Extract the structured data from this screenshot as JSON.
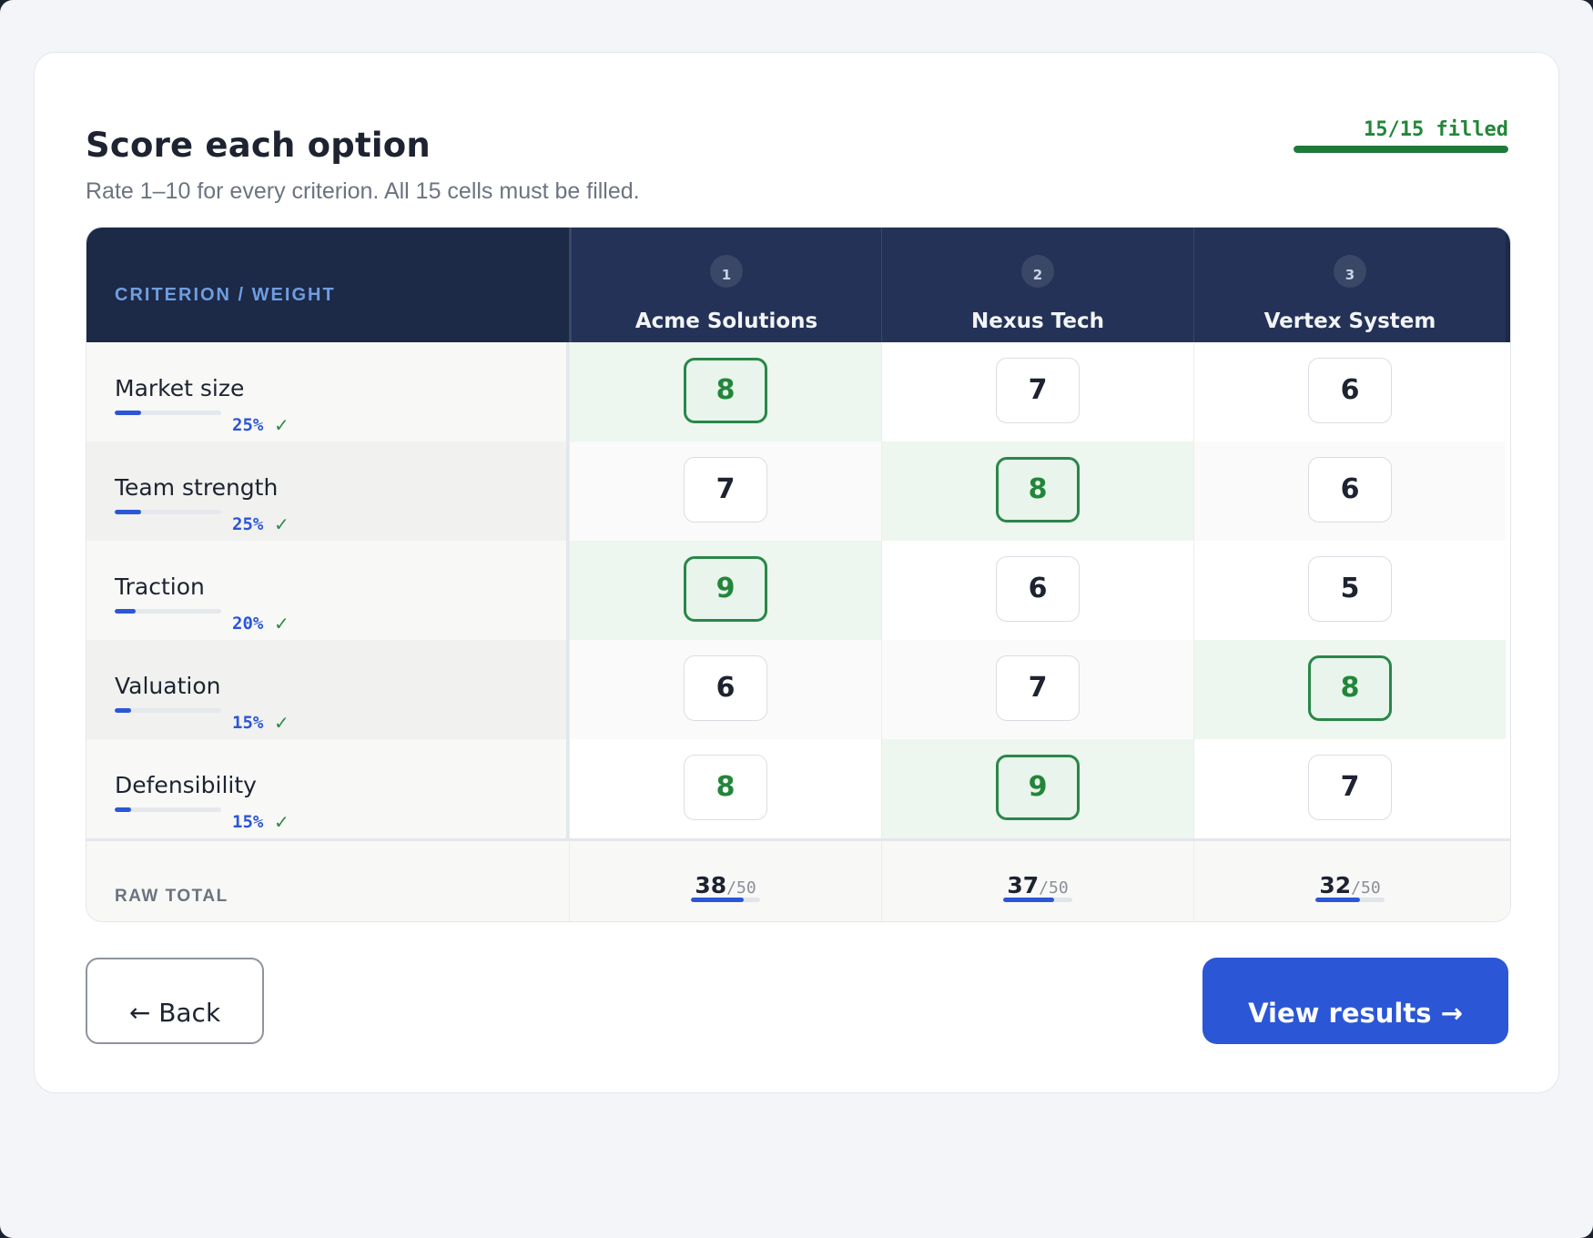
{
  "header": {
    "title": "Score each option",
    "subtitle": "Rate 1–10 for every criterion. All 15 cells must be filled.",
    "progress_label": "15/15 filled",
    "progress_fraction": 1.0
  },
  "table": {
    "criterion_header": "CRITERION / WEIGHT",
    "options": [
      {
        "number": "1",
        "name": "Acme Solutions"
      },
      {
        "number": "2",
        "name": "Nexus Tech"
      },
      {
        "number": "3",
        "name": "Vertex System"
      }
    ],
    "criteria": [
      {
        "name": "Market size",
        "weight": "25%",
        "weight_value": 0.25,
        "check": "✓",
        "scores": [
          "8",
          "7",
          "6"
        ],
        "best_index": 0
      },
      {
        "name": "Team strength",
        "weight": "25%",
        "weight_value": 0.25,
        "check": "✓",
        "scores": [
          "7",
          "8",
          "6"
        ],
        "best_index": 1
      },
      {
        "name": "Traction",
        "weight": "20%",
        "weight_value": 0.2,
        "check": "✓",
        "scores": [
          "9",
          "6",
          "5"
        ],
        "best_index": 0
      },
      {
        "name": "Valuation",
        "weight": "15%",
        "weight_value": 0.15,
        "check": "✓",
        "scores": [
          "6",
          "7",
          "8"
        ],
        "best_index": 2
      },
      {
        "name": "Defensibility",
        "weight": "15%",
        "weight_value": 0.15,
        "check": "✓",
        "scores": [
          "8",
          "9",
          "7"
        ],
        "best_index": 1
      }
    ],
    "totals_label": "RAW TOTAL",
    "totals": [
      {
        "value": "38",
        "max": "/50",
        "fraction": 0.76
      },
      {
        "value": "37",
        "max": "/50",
        "fraction": 0.74
      },
      {
        "value": "32",
        "max": "/50",
        "fraction": 0.64
      }
    ]
  },
  "actions": {
    "back_label": "← Back",
    "next_label": "View results →"
  },
  "colors": {
    "accent": "#2b56d6",
    "success": "#22863a",
    "header_bg": "#1c2947"
  }
}
